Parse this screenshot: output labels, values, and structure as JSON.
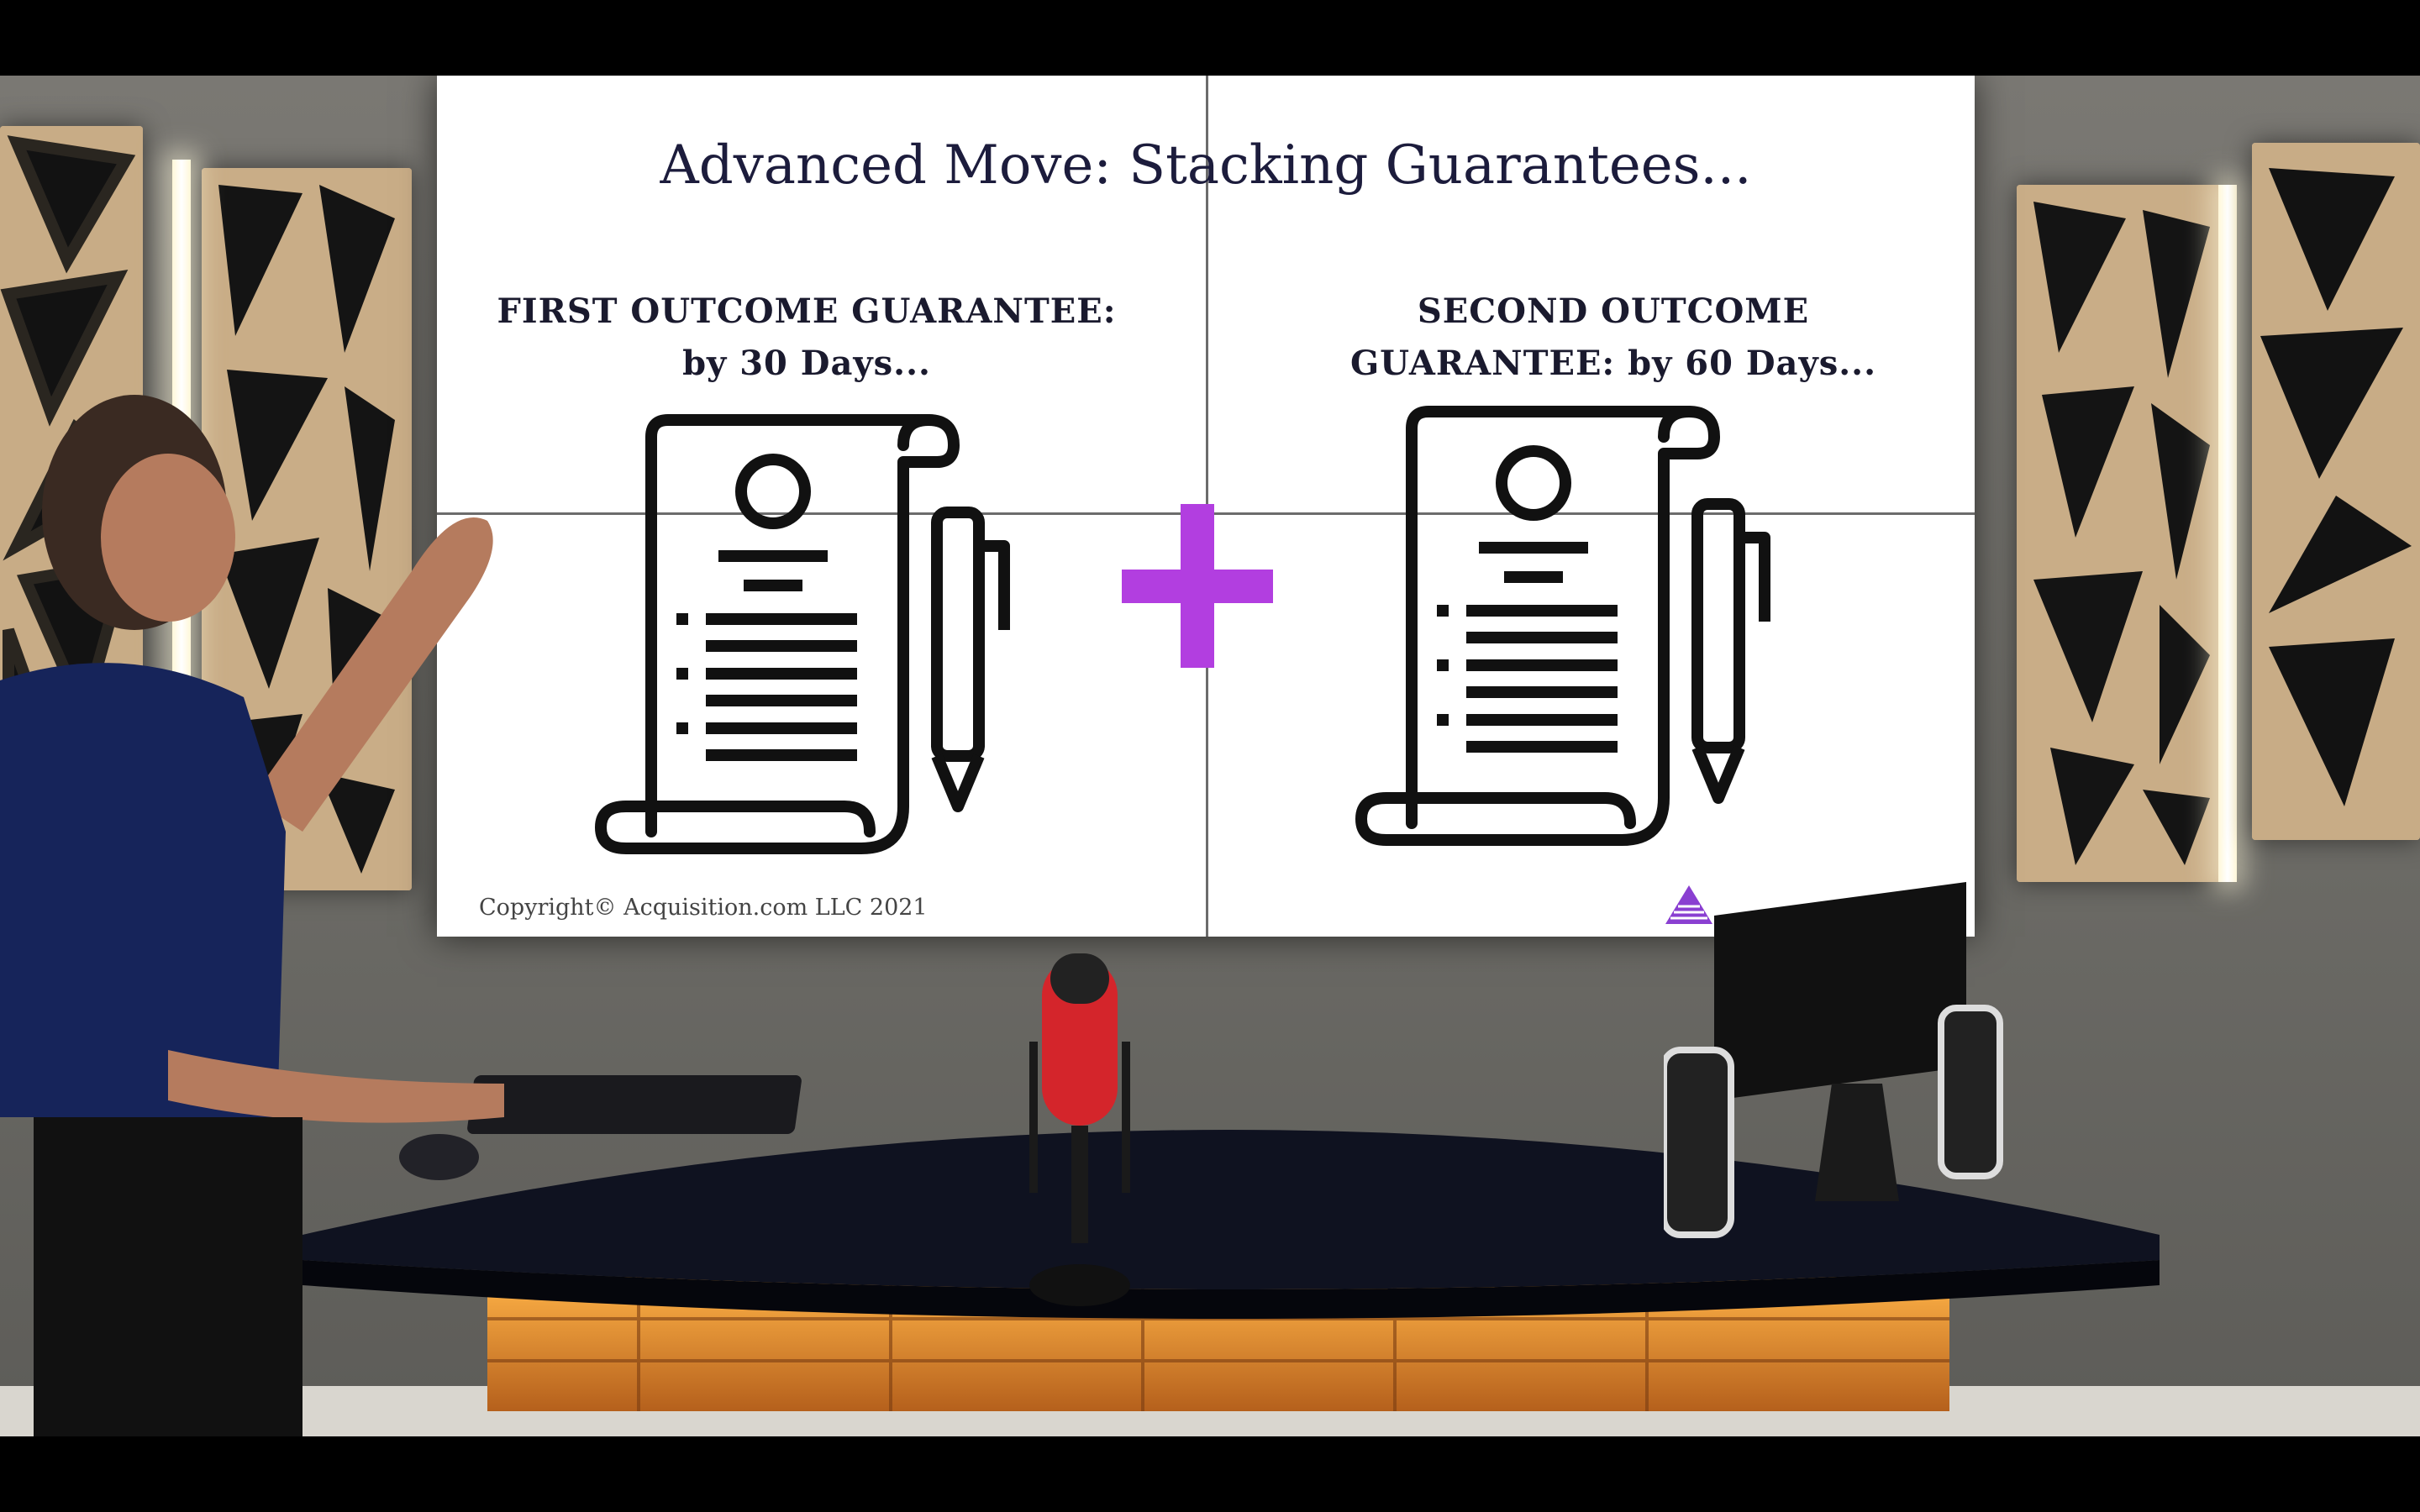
{
  "slide": {
    "title": "Advanced Move: Stacking Guarantees...",
    "left_caption_line1": "FIRST OUTCOME GUARANTEE:",
    "left_caption_line2": "by 30 Days...",
    "right_caption_line1": "SECOND OUTCOME",
    "right_caption_line2": "GUARANTEE: by 60 Days...",
    "copyright": "Copyright© Acquisition.com LLC 2021",
    "icons": [
      "contract-scroll-icon",
      "pen-icon",
      "plus-icon",
      "acquisition-logo-icon"
    ]
  },
  "colors": {
    "plus": "#b23ee0",
    "logo": "#8a3fd1",
    "title_text": "#1c1c3c",
    "desk": "#0f1220",
    "wood_panel": "#c7ab86",
    "mic_red": "#d4252b"
  }
}
